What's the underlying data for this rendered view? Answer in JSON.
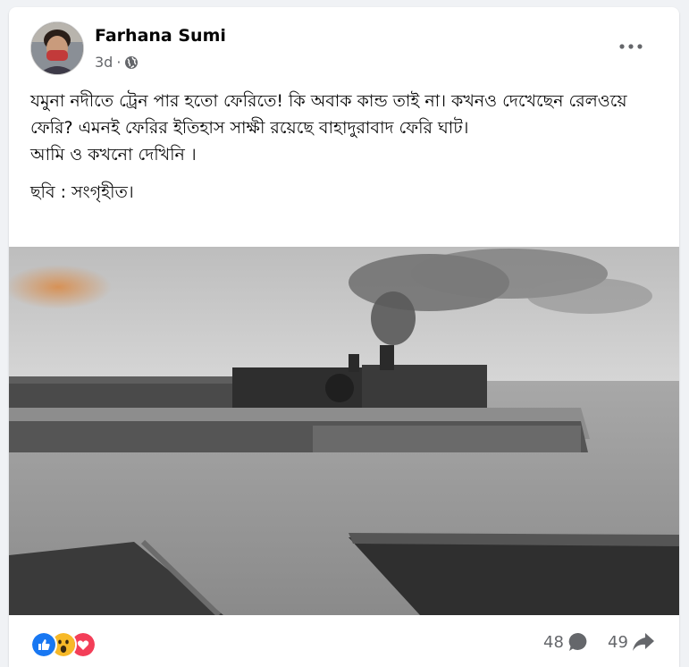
{
  "post": {
    "author": "Farhana Sumi",
    "time": "3d",
    "separator": "·",
    "audience_icon": "globe-icon",
    "menu_icon": "more-options-icon",
    "text_lines": [
      "যমুনা নদীতে ট্রেন পার হতো ফেরিতে! কি অবাক কান্ড তাই না। কখনও দেখেছেন রেলওয়ে ফেরি? এমনই ফেরির ইতিহাস সাক্ষী রয়েছে বাহাদুরাবাদ ফেরি ঘাট।",
      "আমি ও কখনো দেখিনি ।"
    ],
    "credit": "ছবি : সংগৃহীত।"
  },
  "footer": {
    "reaction_icons": [
      "like-icon",
      "wow-icon",
      "love-icon"
    ],
    "comments_count": "48",
    "shares_count": "49"
  },
  "colors": {
    "like": "#1877f2",
    "wow": "#f7b928",
    "love": "#f33e58",
    "secondary_text": "#65676b"
  }
}
